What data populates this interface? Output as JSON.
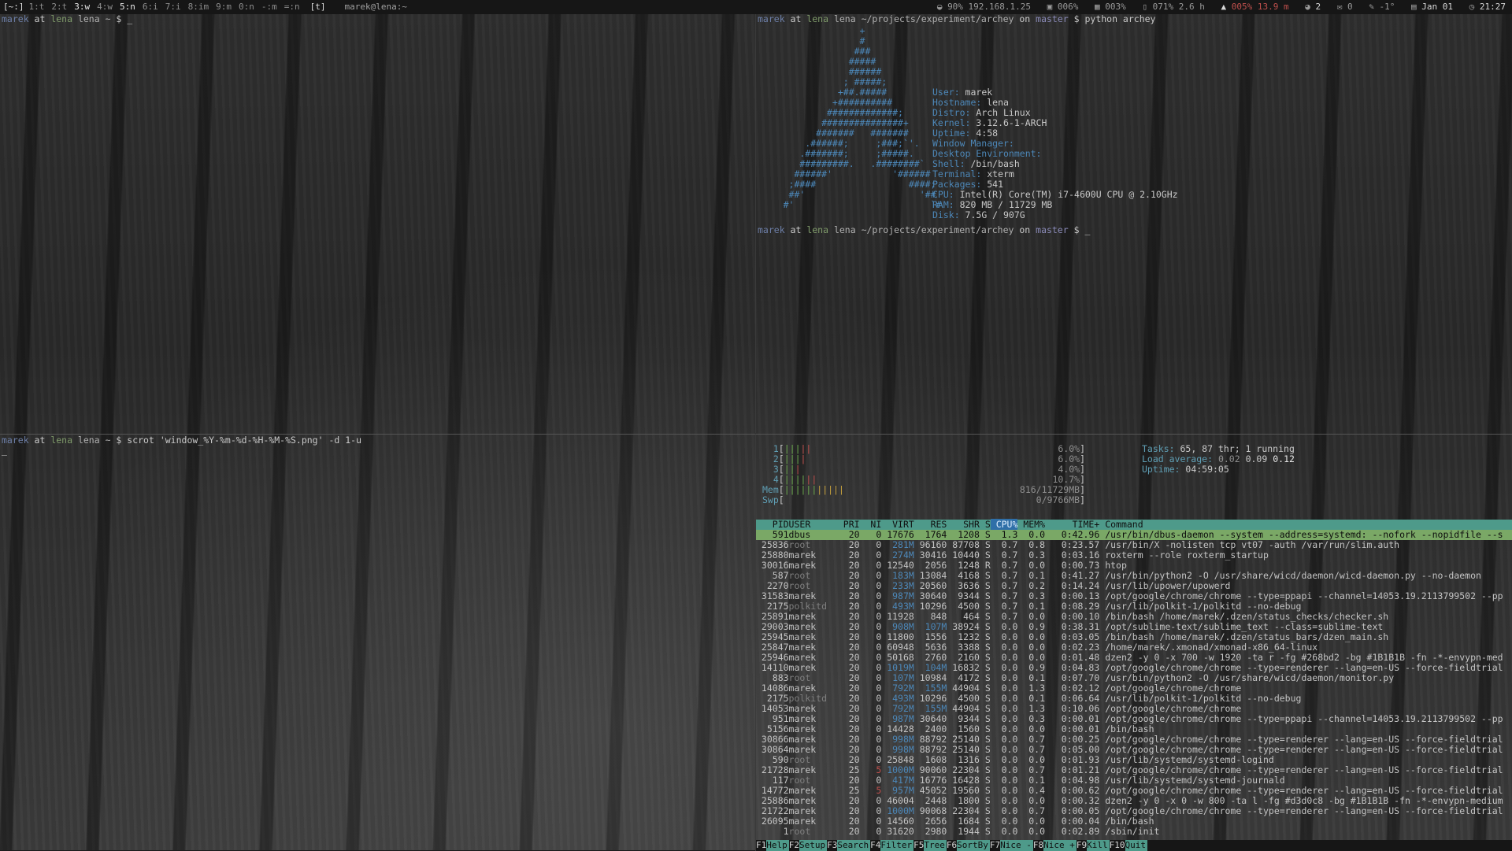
{
  "topbar": {
    "lead": "[~:]",
    "workspaces": [
      {
        "label": "1:t",
        "active": false
      },
      {
        "label": "2:t",
        "active": false
      },
      {
        "label": "3:w",
        "active": true
      },
      {
        "label": "4:w",
        "active": false
      },
      {
        "label": "5:n",
        "active": true
      },
      {
        "label": "6:i",
        "active": false
      },
      {
        "label": "7:i",
        "active": false
      },
      {
        "label": "8:im",
        "active": false
      },
      {
        "label": "9:m",
        "active": false
      },
      {
        "label": "0:n",
        "active": false
      },
      {
        "label": "-:m",
        "active": false
      },
      {
        "label": "=:n",
        "active": false
      }
    ],
    "layout": "[t]",
    "window_title": "marek@lena:~",
    "status": {
      "wifi": "90% 192.168.1.25",
      "cpu": "006%",
      "mem": "003%",
      "battery": "071% 2.6 h",
      "disk_warn": "005% 13.9 m",
      "irc": "2",
      "mail": "0",
      "temp": "-1°",
      "date": "Jan 01",
      "time": "21:27"
    }
  },
  "pane_tl": {
    "prompt": {
      "user": "marek",
      "at": " at ",
      "host": "lena",
      "dir": " lena ~",
      "sigil": " $ ",
      "cmd": "_"
    }
  },
  "pane_bl": {
    "prompt": {
      "user": "marek",
      "at": " at ",
      "host": "lena",
      "dir": " lena ~",
      "sigil": " $ ",
      "cmd": "scrot 'window_%Y-%m-%d-%H-%M-%S.png' -d 1-u"
    },
    "cursor": "_"
  },
  "pane_tr": {
    "prompt1": {
      "user": "marek",
      "at": " at ",
      "host": "lena",
      "dir": " lena ~/projects/experiment/archey",
      "on": " on ",
      "branch": "master",
      "sigil": " $ ",
      "cmd": "python archey"
    },
    "logo": [
      "                   +",
      "                   #",
      "                  ###",
      "                 #####",
      "                 ######",
      "                ; #####;",
      "               +##.#####",
      "              +##########",
      "             #############;",
      "            ###############+",
      "           #######   #######",
      "         .######;     ;###;`'.",
      "        .#######;     ;#####.",
      "        #########.   .########`",
      "       ######'           '######",
      "      ;####                 ####;",
      "      ##'                     '##",
      "     #'                         `#"
    ],
    "info": [
      {
        "label": "User: ",
        "value": "marek"
      },
      {
        "label": "Hostname: ",
        "value": "lena"
      },
      {
        "label": "Distro: ",
        "value": "Arch Linux"
      },
      {
        "label": "Kernel: ",
        "value": "3.12.6-1-ARCH"
      },
      {
        "label": "Uptime: ",
        "value": "4:58"
      },
      {
        "label": "Window Manager: ",
        "value": ""
      },
      {
        "label": "Desktop Environment: ",
        "value": ""
      },
      {
        "label": "Shell: ",
        "value": "/bin/bash"
      },
      {
        "label": "Terminal: ",
        "value": "xterm"
      },
      {
        "label": "Packages: ",
        "value": "541"
      },
      {
        "label": "CPU: ",
        "value": "Intel(R) Core(TM) i7-4600U CPU @ 2.10GHz"
      },
      {
        "label": "RAM: ",
        "value": "820 MB / 11729 MB"
      },
      {
        "label": "Disk: ",
        "value": "7.5G / 907G"
      }
    ],
    "prompt2": {
      "user": "marek",
      "at": " at ",
      "host": "lena",
      "dir": " lena ~/projects/experiment/archey",
      "on": " on ",
      "branch": "master",
      "sigil": " $ ",
      "cmd": "_"
    }
  },
  "htop": {
    "meters": [
      {
        "label": "1",
        "bar_g": "|||",
        "bar_r": "||",
        "bar_y": "",
        "bar_b": "",
        "value": "6.0%"
      },
      {
        "label": "2",
        "bar_g": "|||",
        "bar_r": "|",
        "bar_y": "",
        "bar_b": "",
        "value": "6.0%"
      },
      {
        "label": "3",
        "bar_g": "||",
        "bar_r": "|",
        "bar_y": "",
        "bar_b": "",
        "value": "4.0%"
      },
      {
        "label": "4",
        "bar_g": "||||",
        "bar_r": "||",
        "bar_y": "",
        "bar_b": "",
        "value": "10.7%"
      },
      {
        "label": "Mem",
        "bar_g": "||||||",
        "bar_r": "",
        "bar_y": "|||||",
        "bar_b": "",
        "value": "816/11729MB"
      },
      {
        "label": "Swp",
        "bar_g": "",
        "bar_r": "",
        "bar_y": "",
        "bar_b": "",
        "value": "0/9766MB"
      }
    ],
    "tasks_label": "Tasks: ",
    "tasks": "65, 87 thr; 1 running",
    "load_label": "Load average: ",
    "load1": "0.02",
    "load5": "0.09",
    "load15": "0.12",
    "uptime_label": "Uptime: ",
    "uptime": "04:59:05",
    "header": {
      "pid": "PID",
      "user": "USER",
      "pri": "PRI",
      "ni": "NI",
      "virt": "VIRT",
      "res": "RES",
      "shr": "SHR",
      "s": "S",
      "cpu": "CPU%",
      "mem": "MEM%",
      "time": "TIME+",
      "cmd": "Command"
    },
    "processes": [
      {
        "pid": "591",
        "user": "dbus",
        "pri": "20",
        "ni": "0",
        "virt": "17676",
        "res": "1764",
        "shr": "1208",
        "s": "S",
        "cpu": "1.3",
        "mem": "0.0",
        "time": "0:42.96",
        "cmd": "/usr/bin/dbus-daemon --system --address=systemd: --nofork --nopidfile --s"
      },
      {
        "pid": "25836",
        "user": "root",
        "pri": "20",
        "ni": "0",
        "virt": "281M",
        "res": "96160",
        "shr": "87708",
        "s": "S",
        "cpu": "0.7",
        "mem": "0.8",
        "time": "0:23.57",
        "cmd": "/usr/bin/X -nolisten tcp vt07 -auth /var/run/slim.auth"
      },
      {
        "pid": "25880",
        "user": "marek",
        "pri": "20",
        "ni": "0",
        "virt": "274M",
        "res": "30416",
        "shr": "10440",
        "s": "S",
        "cpu": "0.7",
        "mem": "0.3",
        "time": "0:03.16",
        "cmd": "roxterm --role roxterm_startup"
      },
      {
        "pid": "30016",
        "user": "marek",
        "pri": "20",
        "ni": "0",
        "virt": "12540",
        "res": "2056",
        "shr": "1248",
        "s": "R",
        "cpu": "0.7",
        "mem": "0.0",
        "time": "0:00.73",
        "cmd": "htop"
      },
      {
        "pid": "587",
        "user": "root",
        "pri": "20",
        "ni": "0",
        "virt": "183M",
        "res": "13084",
        "shr": "4168",
        "s": "S",
        "cpu": "0.7",
        "mem": "0.1",
        "time": "0:41.27",
        "cmd": "/usr/bin/python2 -O /usr/share/wicd/daemon/wicd-daemon.py --no-daemon"
      },
      {
        "pid": "2270",
        "user": "root",
        "pri": "20",
        "ni": "0",
        "virt": "233M",
        "res": "20560",
        "shr": "3636",
        "s": "S",
        "cpu": "0.7",
        "mem": "0.2",
        "time": "0:14.24",
        "cmd": "/usr/lib/upower/upowerd"
      },
      {
        "pid": "31583",
        "user": "marek",
        "pri": "20",
        "ni": "0",
        "virt": "987M",
        "res": "30640",
        "shr": "9344",
        "s": "S",
        "cpu": "0.7",
        "mem": "0.3",
        "time": "0:00.13",
        "cmd": "/opt/google/chrome/chrome --type=ppapi --channel=14053.19.2113799502 --pp"
      },
      {
        "pid": "2175",
        "user": "polkitd",
        "pri": "20",
        "ni": "0",
        "virt": "493M",
        "res": "10296",
        "shr": "4500",
        "s": "S",
        "cpu": "0.7",
        "mem": "0.1",
        "time": "0:08.29",
        "cmd": "/usr/lib/polkit-1/polkitd --no-debug"
      },
      {
        "pid": "25891",
        "user": "marek",
        "pri": "20",
        "ni": "0",
        "virt": "11928",
        "res": "848",
        "shr": "464",
        "s": "S",
        "cpu": "0.7",
        "mem": "0.0",
        "time": "0:00.10",
        "cmd": "/bin/bash /home/marek/.dzen/status_checks/checker.sh"
      },
      {
        "pid": "29003",
        "user": "marek",
        "pri": "20",
        "ni": "0",
        "virt": "908M",
        "res": "107M",
        "shr": "38924",
        "s": "S",
        "cpu": "0.0",
        "mem": "0.9",
        "time": "0:38.31",
        "cmd": "/opt/sublime-text/sublime_text --class=sublime-text"
      },
      {
        "pid": "25945",
        "user": "marek",
        "pri": "20",
        "ni": "0",
        "virt": "11800",
        "res": "1556",
        "shr": "1232",
        "s": "S",
        "cpu": "0.0",
        "mem": "0.0",
        "time": "0:03.05",
        "cmd": "/bin/bash /home/marek/.dzen/status_bars/dzen_main.sh"
      },
      {
        "pid": "25847",
        "user": "marek",
        "pri": "20",
        "ni": "0",
        "virt": "60948",
        "res": "5636",
        "shr": "3388",
        "s": "S",
        "cpu": "0.0",
        "mem": "0.0",
        "time": "0:02.23",
        "cmd": "/home/marek/.xmonad/xmonad-x86_64-linux"
      },
      {
        "pid": "25946",
        "user": "marek",
        "pri": "20",
        "ni": "0",
        "virt": "50168",
        "res": "2760",
        "shr": "2160",
        "s": "S",
        "cpu": "0.0",
        "mem": "0.0",
        "time": "0:01.48",
        "cmd": "dzen2 -y 0 -x 700 -w 1920 -ta r -fg #268bd2 -bg #1B1B1B -fn -*-envypn-med"
      },
      {
        "pid": "14110",
        "user": "marek",
        "pri": "20",
        "ni": "0",
        "virt": "1019M",
        "res": "104M",
        "shr": "16832",
        "s": "S",
        "cpu": "0.0",
        "mem": "0.9",
        "time": "0:04.83",
        "cmd": "/opt/google/chrome/chrome --type=renderer --lang=en-US --force-fieldtrial"
      },
      {
        "pid": "883",
        "user": "root",
        "pri": "20",
        "ni": "0",
        "virt": "107M",
        "res": "10984",
        "shr": "4172",
        "s": "S",
        "cpu": "0.0",
        "mem": "0.1",
        "time": "0:07.70",
        "cmd": "/usr/bin/python2 -O /usr/share/wicd/daemon/monitor.py"
      },
      {
        "pid": "14086",
        "user": "marek",
        "pri": "20",
        "ni": "0",
        "virt": "792M",
        "res": "155M",
        "shr": "44904",
        "s": "S",
        "cpu": "0.0",
        "mem": "1.3",
        "time": "0:02.12",
        "cmd": "/opt/google/chrome/chrome"
      },
      {
        "pid": "2175",
        "user": "polkitd",
        "pri": "20",
        "ni": "0",
        "virt": "493M",
        "res": "10296",
        "shr": "4500",
        "s": "S",
        "cpu": "0.0",
        "mem": "0.1",
        "time": "0:06.64",
        "cmd": "/usr/lib/polkit-1/polkitd --no-debug"
      },
      {
        "pid": "14053",
        "user": "marek",
        "pri": "20",
        "ni": "0",
        "virt": "792M",
        "res": "155M",
        "shr": "44904",
        "s": "S",
        "cpu": "0.0",
        "mem": "1.3",
        "time": "0:10.06",
        "cmd": "/opt/google/chrome/chrome"
      },
      {
        "pid": "951",
        "user": "marek",
        "pri": "20",
        "ni": "0",
        "virt": "987M",
        "res": "30640",
        "shr": "9344",
        "s": "S",
        "cpu": "0.0",
        "mem": "0.3",
        "time": "0:00.01",
        "cmd": "/opt/google/chrome/chrome --type=ppapi --channel=14053.19.2113799502 --pp"
      },
      {
        "pid": "5156",
        "user": "marek",
        "pri": "20",
        "ni": "0",
        "virt": "14428",
        "res": "2400",
        "shr": "1560",
        "s": "S",
        "cpu": "0.0",
        "mem": "0.0",
        "time": "0:00.01",
        "cmd": "/bin/bash"
      },
      {
        "pid": "30866",
        "user": "marek",
        "pri": "20",
        "ni": "0",
        "virt": "998M",
        "res": "88792",
        "shr": "25140",
        "s": "S",
        "cpu": "0.0",
        "mem": "0.7",
        "time": "0:00.25",
        "cmd": "/opt/google/chrome/chrome --type=renderer --lang=en-US --force-fieldtrial"
      },
      {
        "pid": "30864",
        "user": "marek",
        "pri": "20",
        "ni": "0",
        "virt": "998M",
        "res": "88792",
        "shr": "25140",
        "s": "S",
        "cpu": "0.0",
        "mem": "0.7",
        "time": "0:05.00",
        "cmd": "/opt/google/chrome/chrome --type=renderer --lang=en-US --force-fieldtrial"
      },
      {
        "pid": "590",
        "user": "root",
        "pri": "20",
        "ni": "0",
        "virt": "25848",
        "res": "1608",
        "shr": "1316",
        "s": "S",
        "cpu": "0.0",
        "mem": "0.0",
        "time": "0:01.93",
        "cmd": "/usr/lib/systemd/systemd-logind"
      },
      {
        "pid": "21728",
        "user": "marek",
        "pri": "25",
        "ni": "5",
        "virt": "1000M",
        "res": "90060",
        "shr": "22304",
        "s": "S",
        "cpu": "0.0",
        "mem": "0.7",
        "time": "0:01.21",
        "cmd": "/opt/google/chrome/chrome --type=renderer --lang=en-US --force-fieldtrial"
      },
      {
        "pid": "117",
        "user": "root",
        "pri": "20",
        "ni": "0",
        "virt": "417M",
        "res": "16776",
        "shr": "16428",
        "s": "S",
        "cpu": "0.0",
        "mem": "0.1",
        "time": "0:04.98",
        "cmd": "/usr/lib/systemd/systemd-journald"
      },
      {
        "pid": "14772",
        "user": "marek",
        "pri": "25",
        "ni": "5",
        "virt": "957M",
        "res": "45052",
        "shr": "19560",
        "s": "S",
        "cpu": "0.0",
        "mem": "0.4",
        "time": "0:00.62",
        "cmd": "/opt/google/chrome/chrome --type=renderer --lang=en-US --force-fieldtrial"
      },
      {
        "pid": "25886",
        "user": "marek",
        "pri": "20",
        "ni": "0",
        "virt": "46004",
        "res": "2448",
        "shr": "1800",
        "s": "S",
        "cpu": "0.0",
        "mem": "0.0",
        "time": "0:00.32",
        "cmd": "dzen2 -y 0 -x 0 -w 800 -ta l -fg #d3d0c8 -bg #1B1B1B -fn -*-envypn-medium"
      },
      {
        "pid": "21722",
        "user": "marek",
        "pri": "20",
        "ni": "0",
        "virt": "1000M",
        "res": "90068",
        "shr": "22304",
        "s": "S",
        "cpu": "0.0",
        "mem": "0.7",
        "time": "0:00.05",
        "cmd": "/opt/google/chrome/chrome --type=renderer --lang=en-US --force-fieldtrial"
      },
      {
        "pid": "26095",
        "user": "marek",
        "pri": "20",
        "ni": "0",
        "virt": "14560",
        "res": "2656",
        "shr": "1684",
        "s": "S",
        "cpu": "0.0",
        "mem": "0.0",
        "time": "0:00.04",
        "cmd": "/bin/bash"
      },
      {
        "pid": "1",
        "user": "root",
        "pri": "20",
        "ni": "0",
        "virt": "31620",
        "res": "2980",
        "shr": "1944",
        "s": "S",
        "cpu": "0.0",
        "mem": "0.0",
        "time": "0:02.89",
        "cmd": "/sbin/init"
      }
    ],
    "fkeys": [
      {
        "key": "F1",
        "label": "Help  "
      },
      {
        "key": "F2",
        "label": "Setup "
      },
      {
        "key": "F3",
        "label": "Search"
      },
      {
        "key": "F4",
        "label": "Filter"
      },
      {
        "key": "F5",
        "label": "Tree  "
      },
      {
        "key": "F6",
        "label": "SortBy"
      },
      {
        "key": "F7",
        "label": "Nice -"
      },
      {
        "key": "F8",
        "label": "Nice +"
      },
      {
        "key": "F9",
        "label": "Kill  "
      },
      {
        "key": "F10",
        "label": "Quit  "
      }
    ]
  }
}
